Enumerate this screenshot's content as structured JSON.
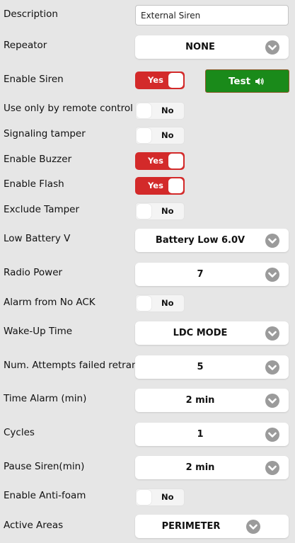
{
  "fields": {
    "description": {
      "label": "Description",
      "value": "External Siren"
    },
    "repeater": {
      "label": "Repeator",
      "value": "NONE"
    },
    "enable_siren": {
      "label": "Enable Siren",
      "state": "Yes"
    },
    "test_button": {
      "label": "Test",
      "icon": "speaker-icon"
    },
    "remote_only": {
      "label": "Use only by remote control",
      "state": "No"
    },
    "signaling_tamper": {
      "label": "Signaling tamper",
      "state": "No"
    },
    "enable_buzzer": {
      "label": "Enable Buzzer",
      "state": "Yes"
    },
    "enable_flash": {
      "label": "Enable Flash",
      "state": "Yes"
    },
    "exclude_tamper": {
      "label": "Exclude Tamper",
      "state": "No"
    },
    "low_battery": {
      "label": "Low Battery V",
      "value": "Battery Low 6.0V"
    },
    "radio_power": {
      "label": "Radio Power",
      "value": "7"
    },
    "alarm_no_ack": {
      "label": "Alarm from No ACK",
      "state": "No"
    },
    "wakeup_time": {
      "label": "Wake-Up Time",
      "value": "LDC MODE"
    },
    "failed_retrans": {
      "label": "Num. Attempts failed retrans.",
      "value": "5"
    },
    "time_alarm": {
      "label": "Time Alarm (min)",
      "value": "2 min"
    },
    "cycles": {
      "label": "Cycles",
      "value": "1"
    },
    "pause_siren": {
      "label": "Pause Siren(min)",
      "value": "2 min"
    },
    "anti_foam": {
      "label": "Enable Anti-foam",
      "state": "No"
    },
    "active_areas": {
      "label": "Active Areas",
      "value": "PERIMETER"
    }
  },
  "colors": {
    "background": "#e6e6e6",
    "toggle_on": "#d32a2a",
    "test_button": "#1a8a1a",
    "chevron": "#9b9b9b"
  }
}
